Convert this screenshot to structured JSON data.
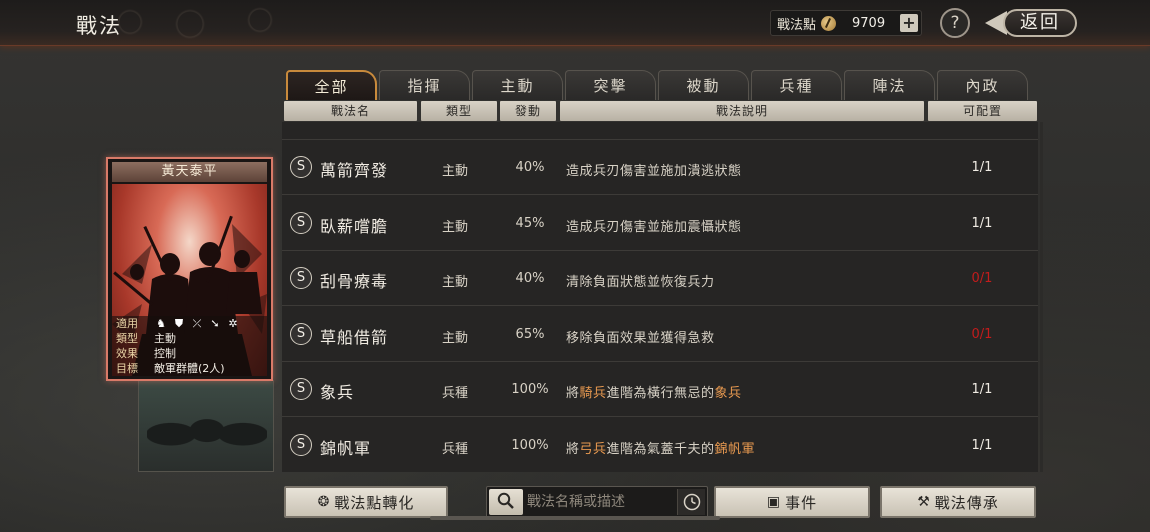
{
  "header": {
    "title": "戰法",
    "points_label": "戰法點",
    "points_value": "9709",
    "plus_label": "+",
    "help_label": "?",
    "back_label": "返回"
  },
  "card": {
    "title": "黃天泰平",
    "fields": [
      {
        "key": "適用",
        "value": ""
      },
      {
        "key": "類型",
        "value": "主動"
      },
      {
        "key": "效果",
        "value": "控制"
      },
      {
        "key": "目標",
        "value": "敵軍群體(2人)"
      }
    ],
    "applies_icons": [
      "cavalry-icon",
      "shield-icon",
      "bow-icon",
      "spear-icon",
      "wheel-icon"
    ]
  },
  "tabs": [
    "全部",
    "指揮",
    "主動",
    "突擊",
    "被動",
    "兵種",
    "陣法",
    "內政"
  ],
  "active_tab": 0,
  "columns": [
    "戰法名",
    "類型",
    "發動",
    "戰法說明",
    "可配置"
  ],
  "rows": [
    {
      "badge": "S",
      "name": "萬箭齊發",
      "type": "主動",
      "rate": "40%",
      "desc": [
        {
          "t": "造成兵刃傷害並施加潰逃狀態",
          "hl": false
        }
      ],
      "cap": "1/1",
      "cap_red": false
    },
    {
      "badge": "S",
      "name": "臥薪嚐膽",
      "type": "主動",
      "rate": "45%",
      "desc": [
        {
          "t": "造成兵刃傷害並施加震懾狀態",
          "hl": false
        }
      ],
      "cap": "1/1",
      "cap_red": false
    },
    {
      "badge": "S",
      "name": "刮骨療毒",
      "type": "主動",
      "rate": "40%",
      "desc": [
        {
          "t": "清除負面狀態並恢復兵力",
          "hl": false
        }
      ],
      "cap": "0/1",
      "cap_red": true
    },
    {
      "badge": "S",
      "name": "草船借箭",
      "type": "主動",
      "rate": "65%",
      "desc": [
        {
          "t": "移除負面效果並獲得急救",
          "hl": false
        }
      ],
      "cap": "0/1",
      "cap_red": true
    },
    {
      "badge": "S",
      "name": "象兵",
      "type": "兵種",
      "rate": "100%",
      "desc": [
        {
          "t": "將",
          "hl": false
        },
        {
          "t": "騎兵",
          "hl": true
        },
        {
          "t": "進階為橫行無忌的",
          "hl": false
        },
        {
          "t": "象兵",
          "hl": true
        }
      ],
      "cap": "1/1",
      "cap_red": false
    },
    {
      "badge": "S",
      "name": "錦帆軍",
      "type": "兵種",
      "rate": "100%",
      "desc": [
        {
          "t": "將",
          "hl": false
        },
        {
          "t": "弓兵",
          "hl": true
        },
        {
          "t": "進階為氣蓋千夫的",
          "hl": false
        },
        {
          "t": "錦帆軍",
          "hl": true
        }
      ],
      "cap": "1/1",
      "cap_red": false
    }
  ],
  "bottom": {
    "convert_label": "戰法點轉化",
    "search_placeholder": "戰法名稱或描述",
    "events_label": "事件",
    "inherit_label": "戰法傳承"
  },
  "colors": {
    "accent_tab_border": "#c88a3c",
    "highlight_text": "#e99a50",
    "unavailable_red": "#c21c1c",
    "card_border": "#d97a68"
  }
}
